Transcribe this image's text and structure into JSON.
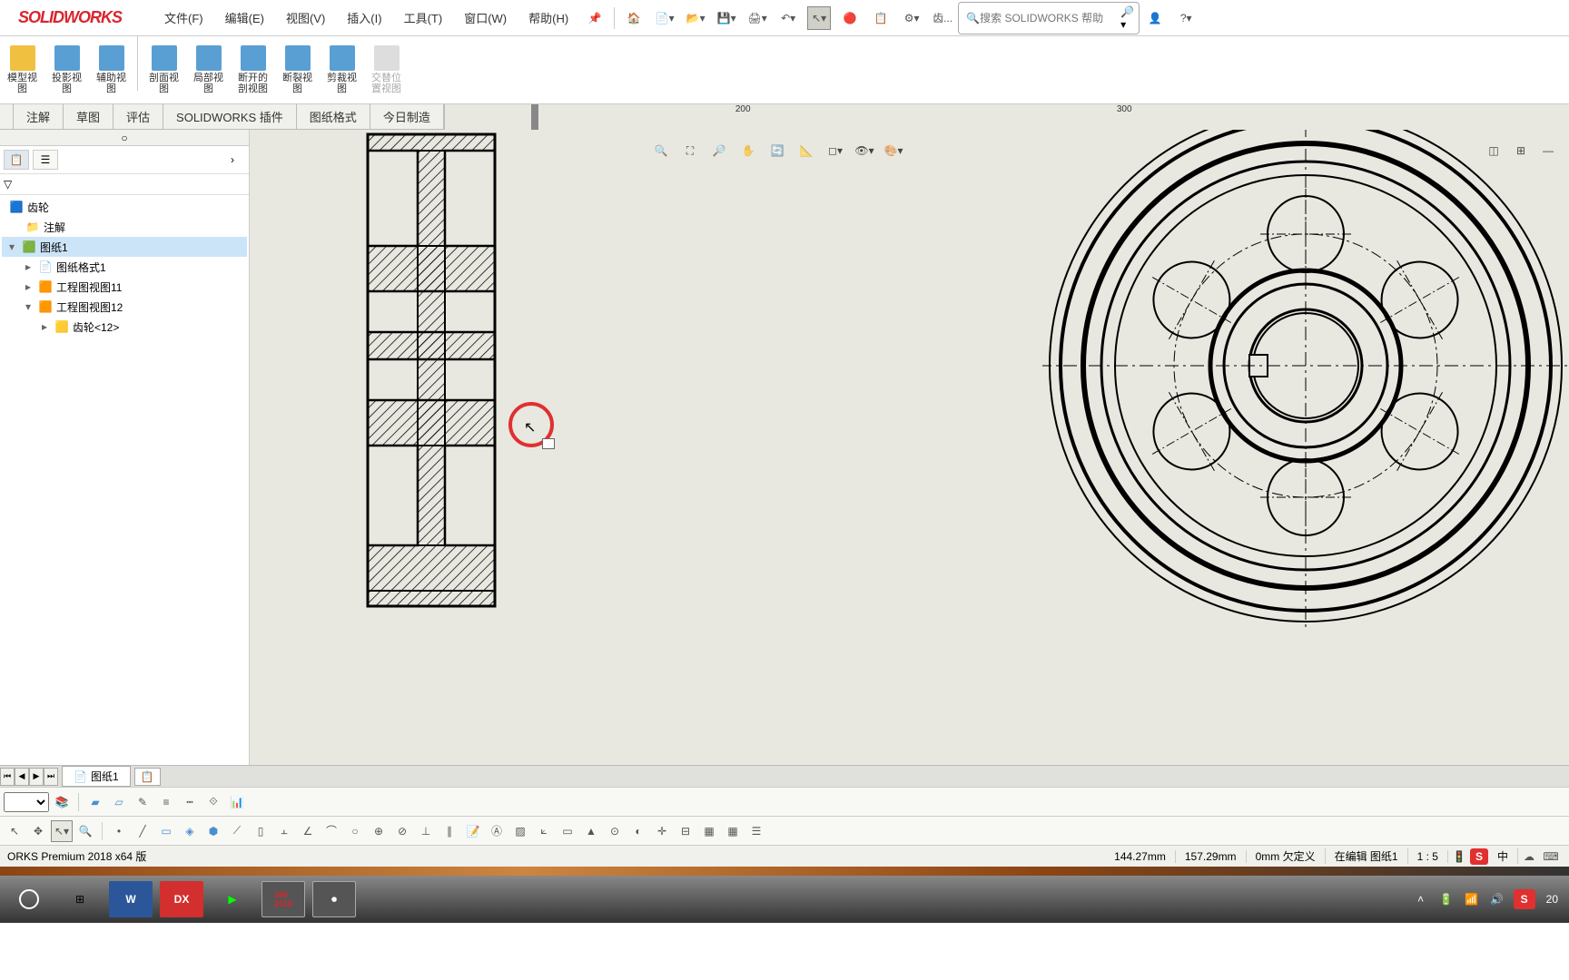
{
  "app": {
    "logo": "SOLIDWORKS"
  },
  "menu": {
    "items": [
      "文件(F)",
      "编辑(E)",
      "视图(V)",
      "插入(I)",
      "工具(T)",
      "窗口(W)",
      "帮助(H)"
    ]
  },
  "search": {
    "placeholder": "搜索 SOLIDWORKS 帮助"
  },
  "ribbon": {
    "items": [
      {
        "label": "模型视\n图"
      },
      {
        "label": "投影视\n图"
      },
      {
        "label": "辅助视\n图"
      },
      {
        "label": "剖面视\n图"
      },
      {
        "label": "局部视\n图"
      },
      {
        "label": "断开的\n剖视图"
      },
      {
        "label": "断裂视\n图"
      },
      {
        "label": "剪裁视\n图"
      },
      {
        "label": "交替位\n置视图"
      }
    ]
  },
  "tabs": {
    "items": [
      "注解",
      "草图",
      "评估",
      "SOLIDWORKS 插件",
      "图纸格式",
      "今日制造"
    ]
  },
  "ruler": {
    "t200": "200",
    "t300": "300"
  },
  "tree": {
    "root": "齿轮",
    "n1": "注解",
    "n2": "图纸1",
    "n3": "图纸格式1",
    "n4": "工程图视图11",
    "n5": "工程图视图12",
    "n6": "齿轮<12>"
  },
  "sheets": {
    "tab1": "图纸1"
  },
  "status": {
    "version": "ORKS Premium 2018 x64 版",
    "x": "144.27mm",
    "y": "157.29mm",
    "z": "0mm",
    "def": "欠定义",
    "edit": "在编辑 图纸1",
    "scale": "1 : 5"
  },
  "tray": {
    "ime": "中",
    "time": "20"
  }
}
